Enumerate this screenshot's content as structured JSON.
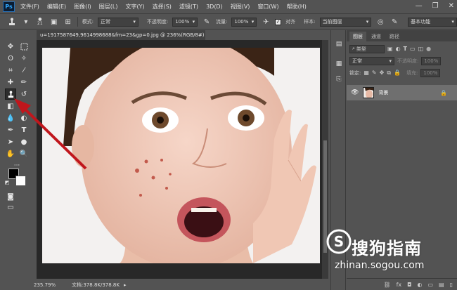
{
  "app": {
    "logo": "Ps"
  },
  "menu": {
    "items": [
      "文件(F)",
      "编辑(E)",
      "图像(I)",
      "图层(L)",
      "文字(Y)",
      "选择(S)",
      "滤镜(T)",
      "3D(D)",
      "视图(V)",
      "窗口(W)",
      "帮助(H)"
    ]
  },
  "window_controls": {
    "minimize": "—",
    "restore": "❐",
    "close": "✕"
  },
  "options": {
    "brush_size": "21",
    "mode_label": "模式:",
    "mode_value": "正常",
    "opacity_label": "不透明度:",
    "opacity_value": "100%",
    "flow_label": "流量:",
    "flow_value": "100%",
    "aligned_label": "对齐",
    "aligned_checked": true,
    "sample_label": "样本:",
    "sample_value": "当前图层",
    "workspace_value": "基本功能"
  },
  "document": {
    "tab_title": "u=1917587649,9614998688&fm=23&gp=0.jpg @ 236%(RGB/8#)",
    "close_glyph": "×"
  },
  "status": {
    "zoom": "235.79%",
    "doc_info": "文档:378.8K/378.8K",
    "arrow": "▸"
  },
  "panel": {
    "tabs": [
      "图层",
      "通道",
      "路径"
    ],
    "active_tab": 0,
    "filter_placeholder": "类型",
    "blend_mode": "正常",
    "opacity_label": "不透明度:",
    "opacity_value": "100%",
    "lock_label": "锁定:",
    "fill_label": "填充:",
    "fill_value": "100%",
    "layer_name": "背景",
    "bottom_icons": [
      "fx",
      "◘",
      "◐",
      "▭",
      "▤",
      "▯"
    ]
  },
  "watermark": {
    "brand": "搜狗指南",
    "url": "zhinan.sogou.com"
  },
  "colors": {
    "ui_bg": "#535353",
    "canvas_bg": "#282828",
    "arrow": "#c0161c"
  }
}
